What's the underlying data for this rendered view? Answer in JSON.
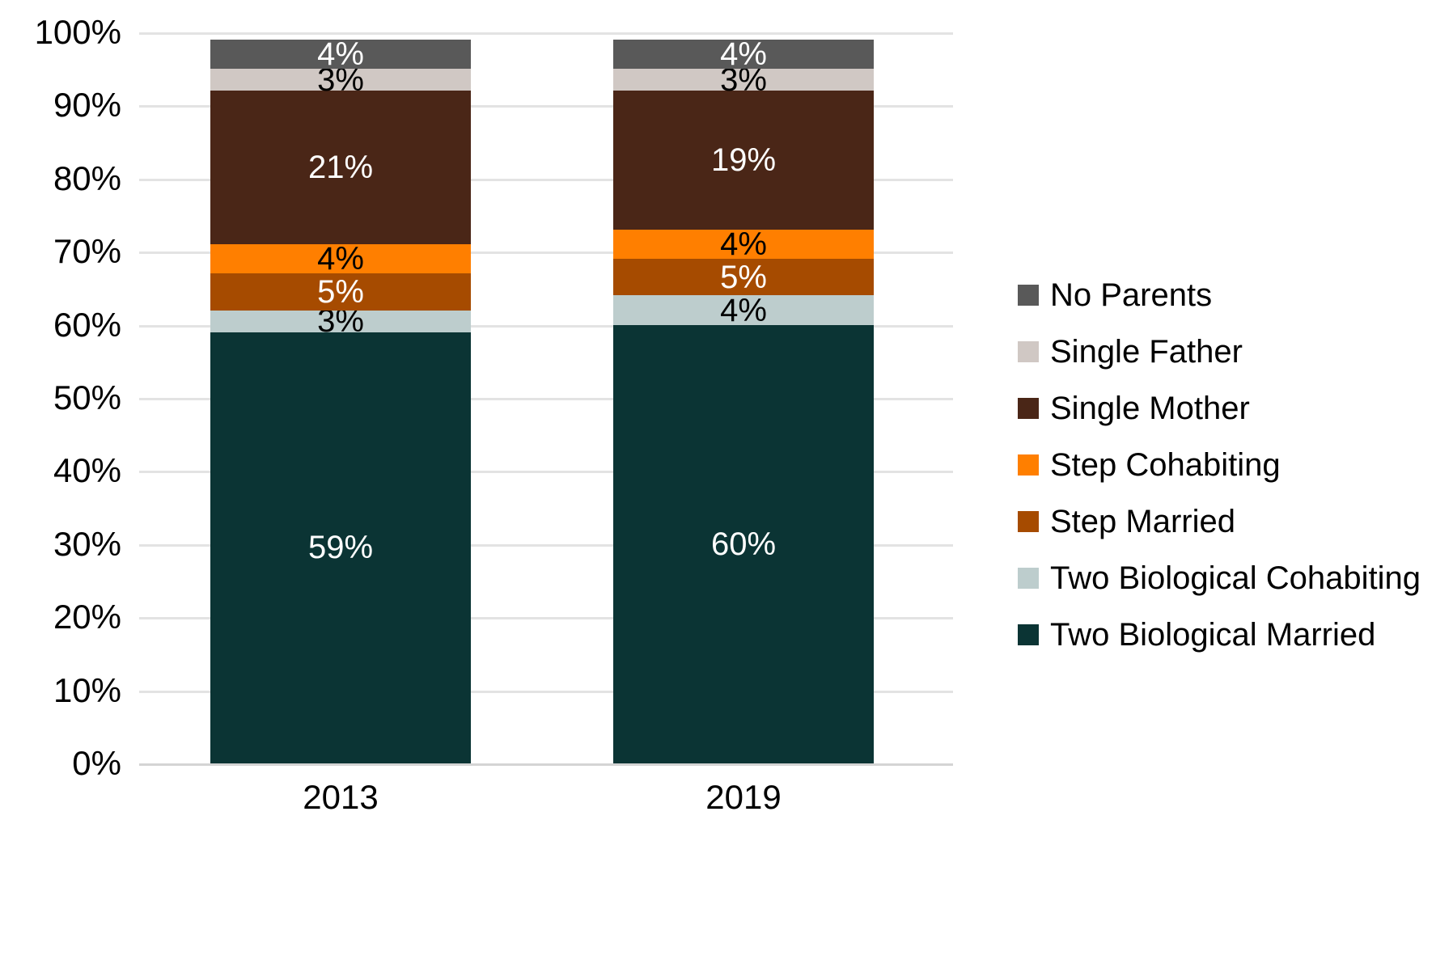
{
  "chart_data": {
    "type": "bar",
    "subtype": "stacked-100-percent",
    "title": "",
    "subtitle": "",
    "xlabel": "",
    "ylabel": "",
    "categories": [
      "2013",
      "2019"
    ],
    "ylim": [
      0,
      100
    ],
    "ytick_labels": [
      "0%",
      "10%",
      "20%",
      "30%",
      "40%",
      "50%",
      "60%",
      "70%",
      "80%",
      "90%",
      "100%"
    ],
    "ytick_values": [
      0,
      10,
      20,
      30,
      40,
      50,
      60,
      70,
      80,
      90,
      100
    ],
    "grid": true,
    "legend_position": "right",
    "series": [
      {
        "name": "Two Biological Married",
        "color": "#0b3434",
        "label_color": "#ffffff",
        "values": [
          59,
          60
        ],
        "labels": [
          "59%",
          "60%"
        ]
      },
      {
        "name": "Two Biological Cohabiting",
        "color": "#bdcdcd",
        "label_color": "#000000",
        "values": [
          3,
          4
        ],
        "labels": [
          "3%",
          "4%"
        ]
      },
      {
        "name": "Step Married",
        "color": "#a64b00",
        "label_color": "#ffffff",
        "values": [
          5,
          5
        ],
        "labels": [
          "5%",
          "5%"
        ]
      },
      {
        "name": "Step Cohabiting",
        "color": "#ff7f00",
        "label_color": "#000000",
        "values": [
          4,
          4
        ],
        "labels": [
          "4%",
          "4%"
        ]
      },
      {
        "name": "Single Mother",
        "color": "#4a2617",
        "label_color": "#ffffff",
        "values": [
          21,
          19
        ],
        "labels": [
          "21%",
          "19%"
        ]
      },
      {
        "name": "Single Father",
        "color": "#d0c8c4",
        "label_color": "#000000",
        "values": [
          3,
          3
        ],
        "labels": [
          "3%",
          "3%"
        ]
      },
      {
        "name": "No Parents",
        "color": "#595959",
        "label_color": "#ffffff",
        "values": [
          4,
          4
        ],
        "labels": [
          "4%",
          "4%"
        ]
      }
    ],
    "legend_entries": [
      {
        "label": "No Parents",
        "color": "#595959"
      },
      {
        "label": "Single Father",
        "color": "#d0c8c4"
      },
      {
        "label": "Single Mother",
        "color": "#4a2617"
      },
      {
        "label": "Step Cohabiting",
        "color": "#ff7f00"
      },
      {
        "label": "Step Married",
        "color": "#a64b00"
      },
      {
        "label": "Two Biological Cohabiting",
        "color": "#bdcdcd"
      },
      {
        "label": "Two Biological Married",
        "color": "#0b3434"
      }
    ]
  },
  "axis": {
    "y_ticks": [
      {
        "label": "100%",
        "value": 100
      },
      {
        "label": "90%",
        "value": 90
      },
      {
        "label": "80%",
        "value": 80
      },
      {
        "label": "70%",
        "value": 70
      },
      {
        "label": "60%",
        "value": 60
      },
      {
        "label": "50%",
        "value": 50
      },
      {
        "label": "40%",
        "value": 40
      },
      {
        "label": "30%",
        "value": 30
      },
      {
        "label": "20%",
        "value": 20
      },
      {
        "label": "10%",
        "value": 10
      },
      {
        "label": "0%",
        "value": 0
      }
    ],
    "x_ticks": [
      {
        "label": "2013"
      },
      {
        "label": "2019"
      }
    ]
  },
  "colors": {
    "background": "#ffffff",
    "gridline": "#e3e3e3",
    "baseline": "#d4d4d4",
    "text": "#000000"
  }
}
